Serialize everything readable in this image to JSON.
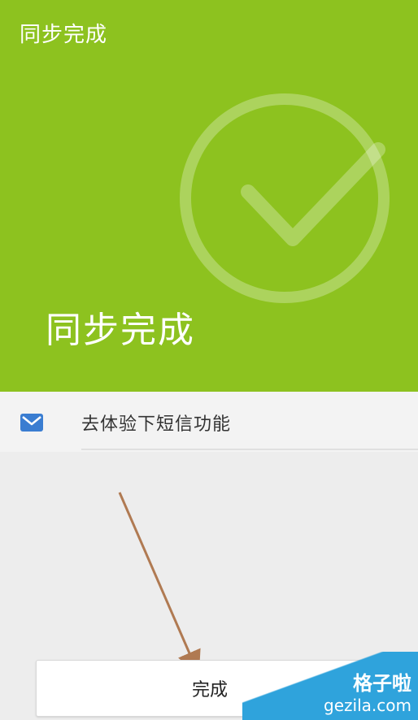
{
  "header": {
    "app_title": "同步完成",
    "big_title": "同步完成",
    "background_color": "#8dc21f",
    "status_icon": "check-circle-icon"
  },
  "sms_item": {
    "label": "去体验下短信功能",
    "icon": "mail-icon",
    "icon_color": "#3a7dd1"
  },
  "actions": {
    "done_label": "完成"
  },
  "annotation": {
    "arrow_color": "#b07a52"
  },
  "watermark": {
    "name": "格子啦",
    "url": "gezila.com",
    "color": "#2fa3dc"
  }
}
